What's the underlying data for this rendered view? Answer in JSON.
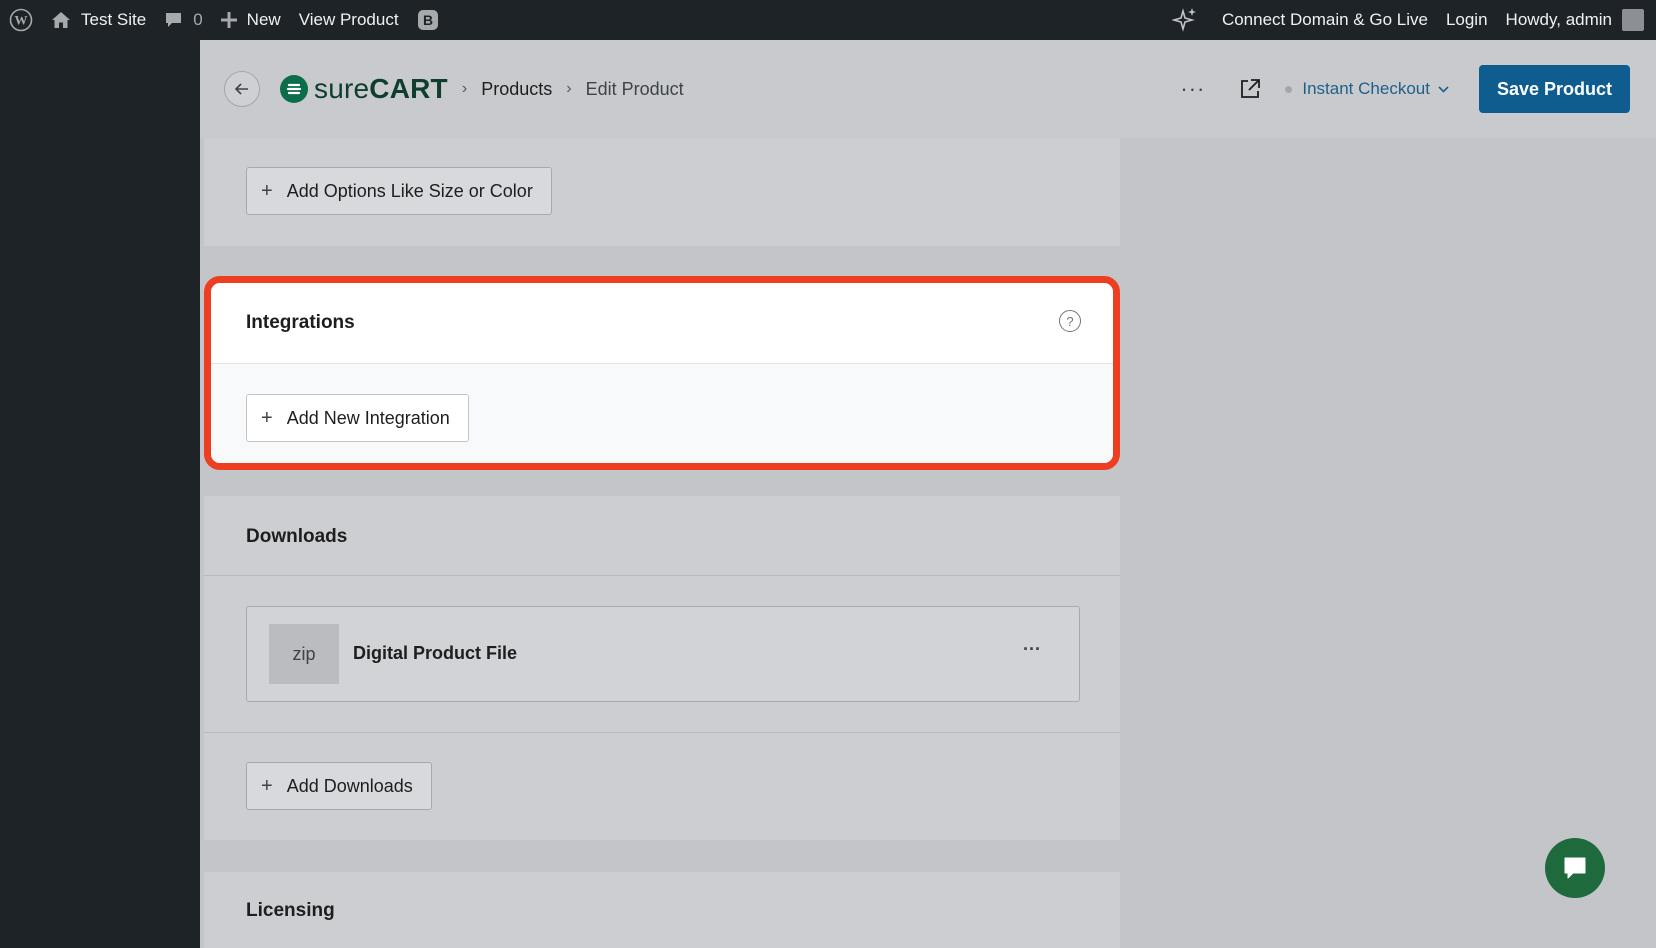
{
  "adminbar": {
    "site_name": "Test Site",
    "comments_count": "0",
    "new_label": "New",
    "view_product": "View Product",
    "connect_domain": "Connect Domain & Go Live",
    "login": "Login",
    "howdy": "Howdy, admin"
  },
  "header": {
    "logo_light": "sure",
    "logo_bold": "CART",
    "breadcrumb_products": "Products",
    "breadcrumb_edit": "Edit Product",
    "checkout_label": "Instant Checkout",
    "save_label": "Save Product"
  },
  "options_card": {
    "button_label": "Add Options Like Size or Color"
  },
  "integrations": {
    "title": "Integrations",
    "help_glyph": "?",
    "button_label": "Add New Integration",
    "highlight_color": "#ee3e22"
  },
  "downloads": {
    "title": "Downloads",
    "file_type": "zip",
    "file_name": "Digital Product File",
    "file_menu": "···",
    "button_label": "Add Downloads"
  },
  "licensing": {
    "title": "Licensing"
  },
  "icons": {
    "wordpress": "wordpress-logo-icon",
    "home": "home-icon",
    "comment": "comment-bubble-icon",
    "plus": "plus-icon",
    "beaver": "builder-b-icon",
    "sparkle": "sparkle-ai-icon",
    "back": "arrow-left-icon",
    "more": "more-horizontal-icon",
    "external": "external-link-icon",
    "chevron": "chevron-down-icon",
    "help": "help-circle-icon",
    "chat": "chat-bubble-icon"
  },
  "colors": {
    "primary": "#0e5d8e",
    "brand_green": "#0b6d49",
    "admin_dark": "#1d2327"
  }
}
